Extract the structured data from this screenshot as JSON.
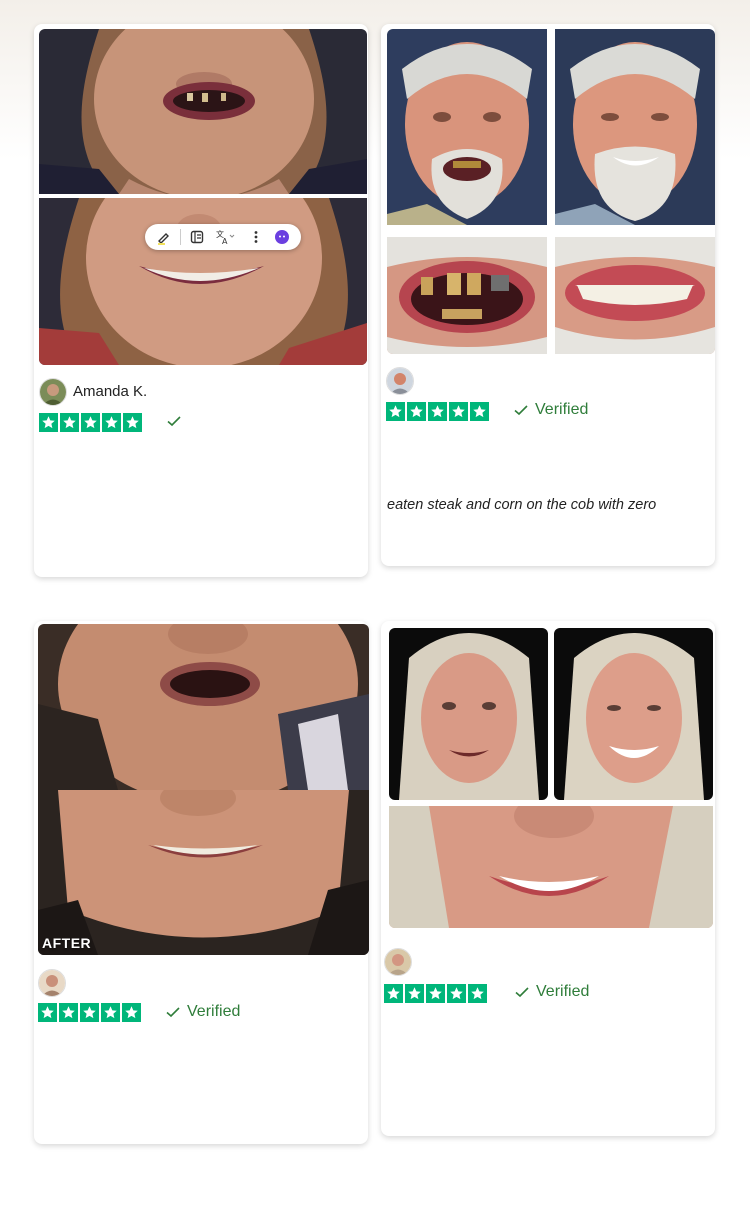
{
  "reviews": [
    {
      "name": "Amanda K.",
      "rating": 5,
      "verified_label": "",
      "quote": "",
      "photo_alt": [
        "before-smile",
        "after-smile"
      ]
    },
    {
      "name": "",
      "rating": 5,
      "verified_label": "Verified",
      "quote": "eaten steak and corn on the cob with zero"
    },
    {
      "name": "",
      "rating": 5,
      "verified_label": "Verified",
      "quote": "",
      "after_label": "AFTER"
    },
    {
      "name": "",
      "rating": 5,
      "verified_label": "Verified",
      "quote": ""
    }
  ],
  "colors": {
    "star_green": "#00b67a",
    "verified_green": "#2f7d3a",
    "card_bg": "#ffffff"
  },
  "icons": {
    "toolbar": [
      "highlighter-icon",
      "notes-icon",
      "translate-icon",
      "more-vertical-icon",
      "assistant-icon"
    ],
    "star": "star-icon",
    "check": "check-icon"
  }
}
